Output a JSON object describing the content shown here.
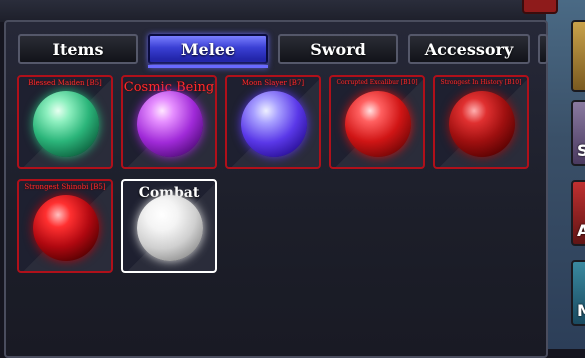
{
  "tabs": [
    {
      "label": "Items",
      "active": false
    },
    {
      "label": "Melee",
      "active": true
    },
    {
      "label": "Sword",
      "active": false
    },
    {
      "label": "Accessory",
      "active": false
    }
  ],
  "slots": [
    {
      "name": "Blessed Maiden [B5]",
      "orb": "green-orb-icon"
    },
    {
      "name": "Cosmic Being",
      "orb": "purple-orb-icon"
    },
    {
      "name": "Moon Slayer [B7]",
      "orb": "violet-orb-icon"
    },
    {
      "name": "Corrupted Excalibur [B10]",
      "orb": "red-orb-icon"
    },
    {
      "name": "Strongest In History [B10]",
      "orb": "dark-red-orb-icon"
    },
    {
      "name": "Strongest Shinobi [B5]",
      "orb": "crimson-orb-icon"
    },
    {
      "name": "Combat",
      "orb": "white-orb-icon",
      "selected": true
    }
  ],
  "side_buttons": [
    "S",
    "A",
    "M"
  ],
  "colors": {
    "accent": "#3a3fd4",
    "slot_border": "#b0101a",
    "selected_border": "#ffffff",
    "label_red": "#ff2a2a"
  }
}
